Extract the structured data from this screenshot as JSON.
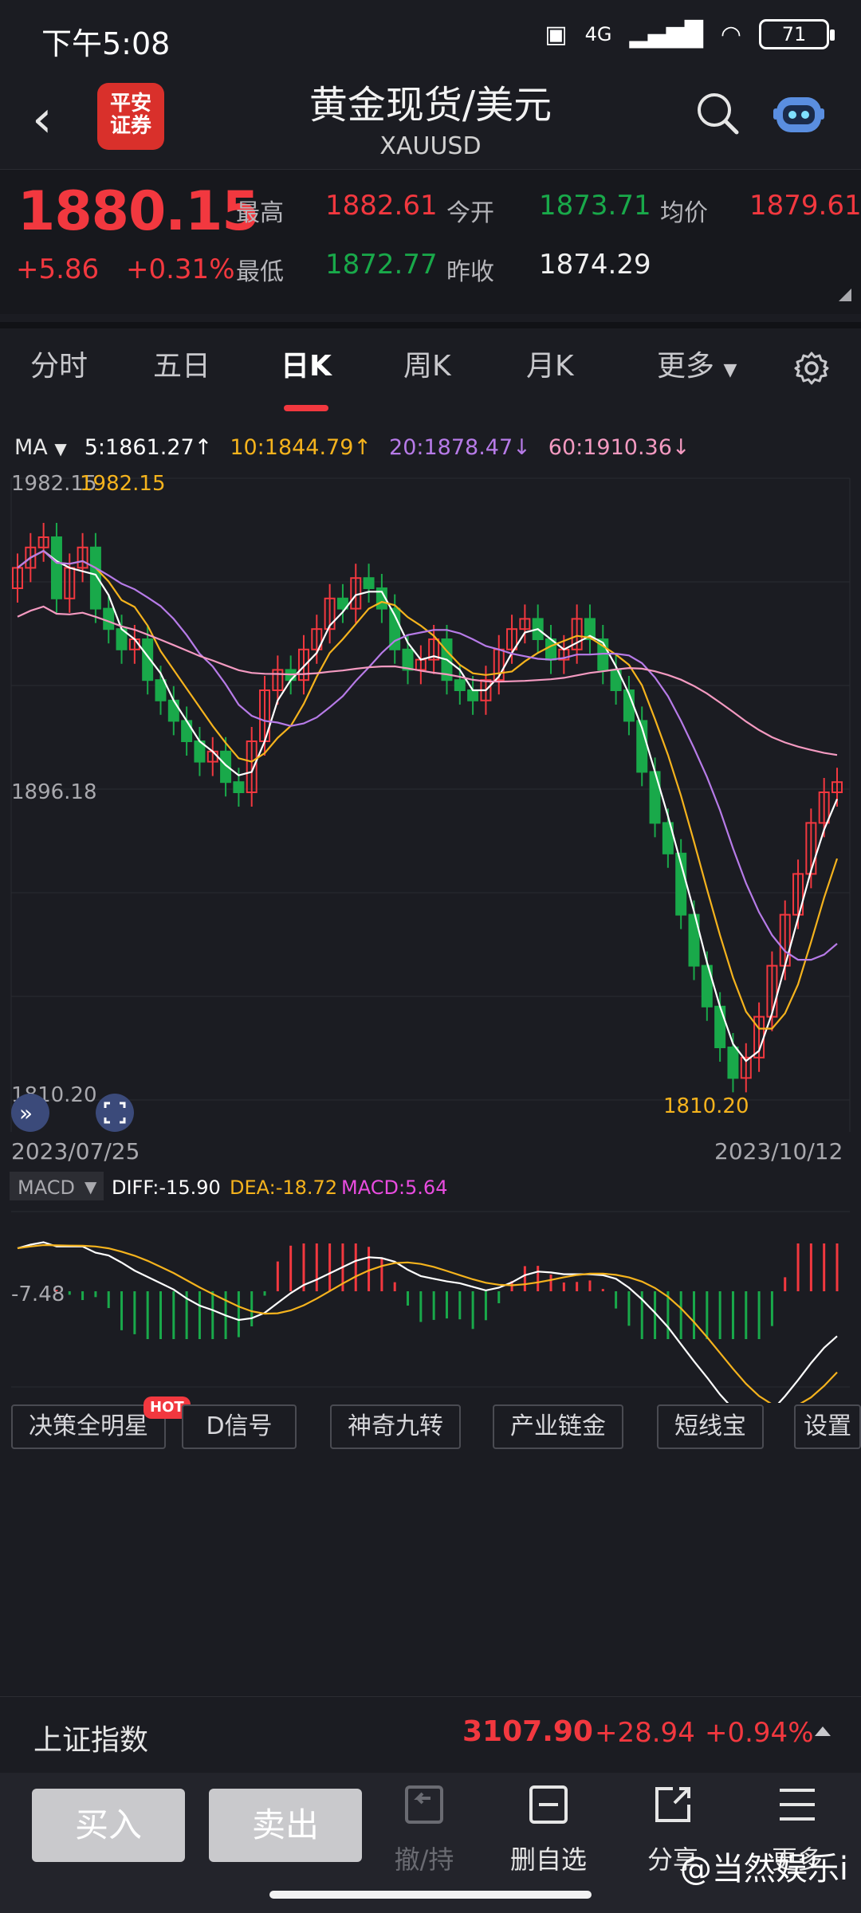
{
  "status_bar": {
    "time": "下午5:08",
    "network": "4G",
    "battery": "71"
  },
  "header": {
    "logo_text_line1": "平安",
    "logo_text_line2": "证券",
    "title": "黄金现货/美元",
    "subtitle": "XAUUSD"
  },
  "quote": {
    "price": "1880.15",
    "change": "+5.86",
    "change_pct": "+0.31%",
    "high_label": "最高",
    "high": "1882.61",
    "open_label": "今开",
    "open": "1873.71",
    "avg_label": "均价",
    "avg": "1879.61",
    "low_label": "最低",
    "low": "1872.77",
    "prev_close_label": "昨收",
    "prev_close": "1874.29"
  },
  "tabs": [
    {
      "label": "分时"
    },
    {
      "label": "五日"
    },
    {
      "label": "日K"
    },
    {
      "label": "周K"
    },
    {
      "label": "月K"
    },
    {
      "label": "更多"
    }
  ],
  "ma": {
    "label": "MA",
    "ma5": "5:1861.27↑",
    "ma10": "10:1844.79↑",
    "ma20": "20:1878.47↓",
    "ma60": "60:1910.36↓"
  },
  "chart_data": {
    "type": "candlestick",
    "y_top_label": "1982.15",
    "y_mid_label": "1896.18",
    "y_bottom_label": "1810.20",
    "max_marker": "1982.15",
    "min_marker": "1810.20",
    "start_date": "2023/07/25",
    "end_date": "2023/10/12",
    "colors": {
      "up": "#f2383f",
      "down": "#19a94a",
      "ma5": "#ffffff",
      "ma10": "#f5b31d",
      "ma20": "#b77be8",
      "ma60": "#f49ac1"
    }
  },
  "macd": {
    "label": "MACD",
    "diff": "DIFF:-15.90",
    "dea": "DEA:-18.72",
    "macd": "MACD:5.64",
    "axis_label": "-7.48"
  },
  "tools": [
    {
      "label": "决策全明星"
    },
    {
      "label": "D信号"
    },
    {
      "label": "神奇九转"
    },
    {
      "label": "产业链金"
    },
    {
      "label": "短线宝"
    },
    {
      "label": "设置"
    }
  ],
  "hot_badge": "HOT",
  "index": {
    "name": "上证指数",
    "value": "3107.90",
    "change": "+28.94",
    "change_pct": "+0.94%"
  },
  "bottom": {
    "buy": "买入",
    "sell": "卖出",
    "cancel": "撤/持",
    "remove_watch": "删自选",
    "share": "分享",
    "more": "更多"
  },
  "watermark": "@当然娱乐i"
}
